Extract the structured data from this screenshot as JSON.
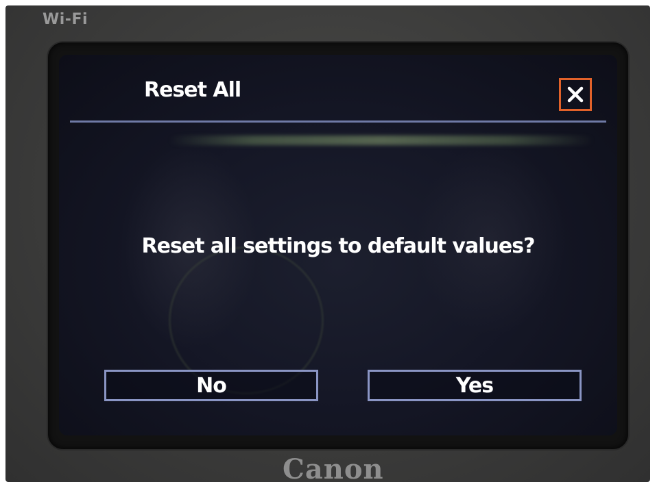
{
  "camera": {
    "wifi_label": "Wi-Fi",
    "brand": "Canon"
  },
  "dialog": {
    "title": "Reset All",
    "message": "Reset all settings to default values?",
    "close_icon": "close-icon",
    "buttons": {
      "no_label": "No",
      "yes_label": "Yes"
    }
  },
  "colors": {
    "screen_background": "#151726",
    "accent_divider": "#6f7aa6",
    "button_border": "#8a95c4",
    "close_highlight": "#e2622a",
    "text": "#ffffff"
  }
}
